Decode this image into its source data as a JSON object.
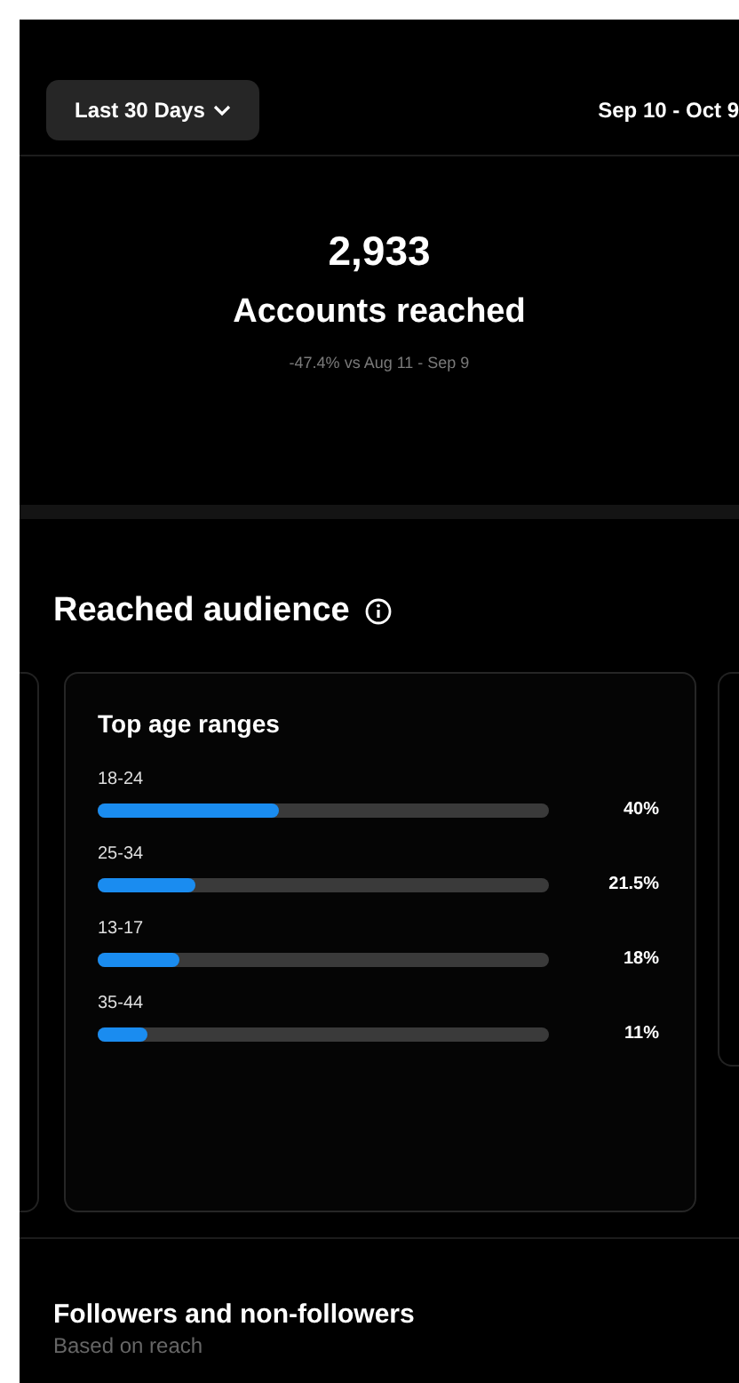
{
  "header": {
    "period_button": "Last 30 Days",
    "date_range": "Sep 10 - Oct 9"
  },
  "summary": {
    "value": "2,933",
    "label": "Accounts reached",
    "comparison": "-47.4% vs Aug 11 - Sep 9"
  },
  "audience": {
    "title": "Reached audience",
    "card": {
      "title": "Top age ranges",
      "ranges": [
        {
          "label": "18-24",
          "level": 0.4,
          "percent": "40%"
        },
        {
          "label": "25-34",
          "level": 0.215,
          "percent": "21.5%"
        },
        {
          "label": "13-17",
          "level": 0.18,
          "percent": "18%"
        },
        {
          "label": "35-44",
          "level": 0.11,
          "percent": "11%"
        }
      ]
    }
  },
  "followers": {
    "title": "Followers and non-followers",
    "subtitle": "Based on reach"
  }
}
